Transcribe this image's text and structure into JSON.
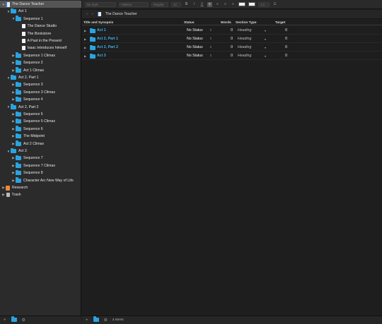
{
  "binder": {
    "items": [
      {
        "label": "The Dance Teacher",
        "icon": "book-icon",
        "disc": "▼",
        "indent": 0,
        "selected": true
      },
      {
        "label": "Act 1",
        "icon": "folder-icon",
        "disc": "▼",
        "indent": 1
      },
      {
        "label": "Sequence 1",
        "icon": "folder-icon",
        "disc": "▼",
        "indent": 2
      },
      {
        "label": "The Dance Studio",
        "icon": "document-icon",
        "disc": "",
        "indent": 3
      },
      {
        "label": "The Bookstore",
        "icon": "document-icon",
        "disc": "",
        "indent": 3
      },
      {
        "label": "A Past in the Present",
        "icon": "document-icon",
        "disc": "",
        "indent": 3
      },
      {
        "label": "Isaac introduces himself",
        "icon": "document-icon",
        "disc": "",
        "indent": 3
      },
      {
        "label": "Sequence 1 Climax",
        "icon": "folder-icon",
        "disc": "▶",
        "indent": 2
      },
      {
        "label": "Sequence 2",
        "icon": "folder-icon",
        "disc": "▶",
        "indent": 2
      },
      {
        "label": "Act 1 Climax",
        "icon": "folder-icon",
        "disc": "▶",
        "indent": 2
      },
      {
        "label": "Act 2, Part 1",
        "icon": "folder-icon",
        "disc": "▼",
        "indent": 1
      },
      {
        "label": "Sequence 3",
        "icon": "folder-icon",
        "disc": "▶",
        "indent": 2
      },
      {
        "label": "Sequence 3 Climax",
        "icon": "folder-icon",
        "disc": "▶",
        "indent": 2
      },
      {
        "label": "Sequence 4",
        "icon": "folder-icon",
        "disc": "▶",
        "indent": 2
      },
      {
        "label": "Act 2, Part 2",
        "icon": "folder-icon",
        "disc": "▼",
        "indent": 1
      },
      {
        "label": "Sequence 5",
        "icon": "folder-icon",
        "disc": "▶",
        "indent": 2
      },
      {
        "label": "Sequence 5 Climax",
        "icon": "folder-icon",
        "disc": "▶",
        "indent": 2
      },
      {
        "label": "Sequence 6",
        "icon": "folder-icon",
        "disc": "▶",
        "indent": 2
      },
      {
        "label": "The Midpoint",
        "icon": "folder-icon",
        "disc": "▶",
        "indent": 2
      },
      {
        "label": "Act 2 Climax",
        "icon": "folder-icon",
        "disc": "▶",
        "indent": 2
      },
      {
        "label": "Act 3",
        "icon": "folder-icon",
        "disc": "▼",
        "indent": 1
      },
      {
        "label": "Sequence 7",
        "icon": "folder-icon",
        "disc": "▶",
        "indent": 2
      },
      {
        "label": "Sequence 7 Climax",
        "icon": "folder-icon",
        "disc": "▶",
        "indent": 2
      },
      {
        "label": "Sequence 8",
        "icon": "folder-icon",
        "disc": "▶",
        "indent": 2
      },
      {
        "label": "Character Arc New Way of Life",
        "icon": "folder-icon",
        "disc": "▶",
        "indent": 2
      },
      {
        "label": "Research",
        "icon": "research-icon",
        "disc": "▶",
        "indent": 0
      },
      {
        "label": "Trash",
        "icon": "trash-icon",
        "disc": "▶",
        "indent": 0
      }
    ]
  },
  "formatbar": {
    "style_placeholder": "No Style",
    "font_placeholder": "Palatino",
    "weight_placeholder": "Regular",
    "size_value": "12",
    "bold": "B",
    "italic": "I",
    "underline": "U",
    "spacing": "1.0"
  },
  "navbar": {
    "back": "‹",
    "forward": "›",
    "title": "The Dance Teacher"
  },
  "outline": {
    "columns": {
      "title": "Title and Synopsis",
      "status": "Status",
      "words": "Words",
      "section_type": "Section Type",
      "target": "Target"
    },
    "rows": [
      {
        "title": "Act 1",
        "status": "No Status",
        "words": "0",
        "section_type": "Heading",
        "target": "0"
      },
      {
        "title": "Act 2, Part 1",
        "status": "No Status",
        "words": "0",
        "section_type": "Heading",
        "target": "0"
      },
      {
        "title": "Act 2, Part 2",
        "status": "No Status",
        "words": "0",
        "section_type": "Heading",
        "target": "0"
      },
      {
        "title": "Act 3",
        "status": "No Status",
        "words": "0",
        "section_type": "Heading",
        "target": "0"
      }
    ]
  },
  "footer": {
    "item_count": "4 Items",
    "add": "+",
    "settings": "⚙"
  },
  "colors": {
    "accent": "#2aa4e0",
    "background": "#1e1e1e",
    "sidebar": "#2b2b2b"
  }
}
